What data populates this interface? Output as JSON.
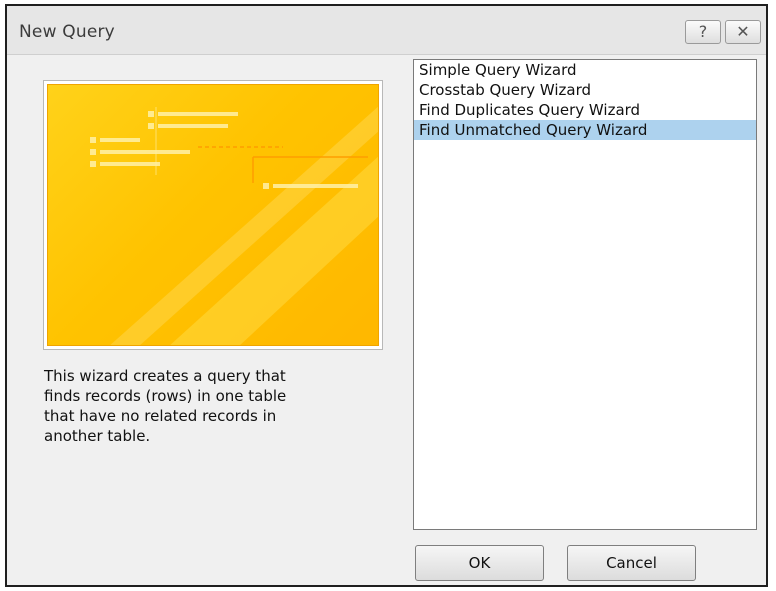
{
  "window": {
    "title": "New Query",
    "help_glyph": "?",
    "close_glyph": "✕"
  },
  "preview": {
    "icon": "query-wizard-illustration",
    "colors": {
      "background": "#ffc300",
      "lines": "#fff1a8"
    }
  },
  "description": [
    "This wizard creates a query that",
    "finds records (rows) in one table",
    "that have no related records in",
    "another table."
  ],
  "wizard_list": {
    "items": [
      "Simple Query Wizard",
      "Crosstab Query Wizard",
      "Find Duplicates Query Wizard",
      "Find Unmatched Query Wizard"
    ],
    "selected": "Find Unmatched Query Wizard",
    "selection_color": "#add2ee"
  },
  "buttons": {
    "ok": "OK",
    "cancel": "Cancel"
  }
}
